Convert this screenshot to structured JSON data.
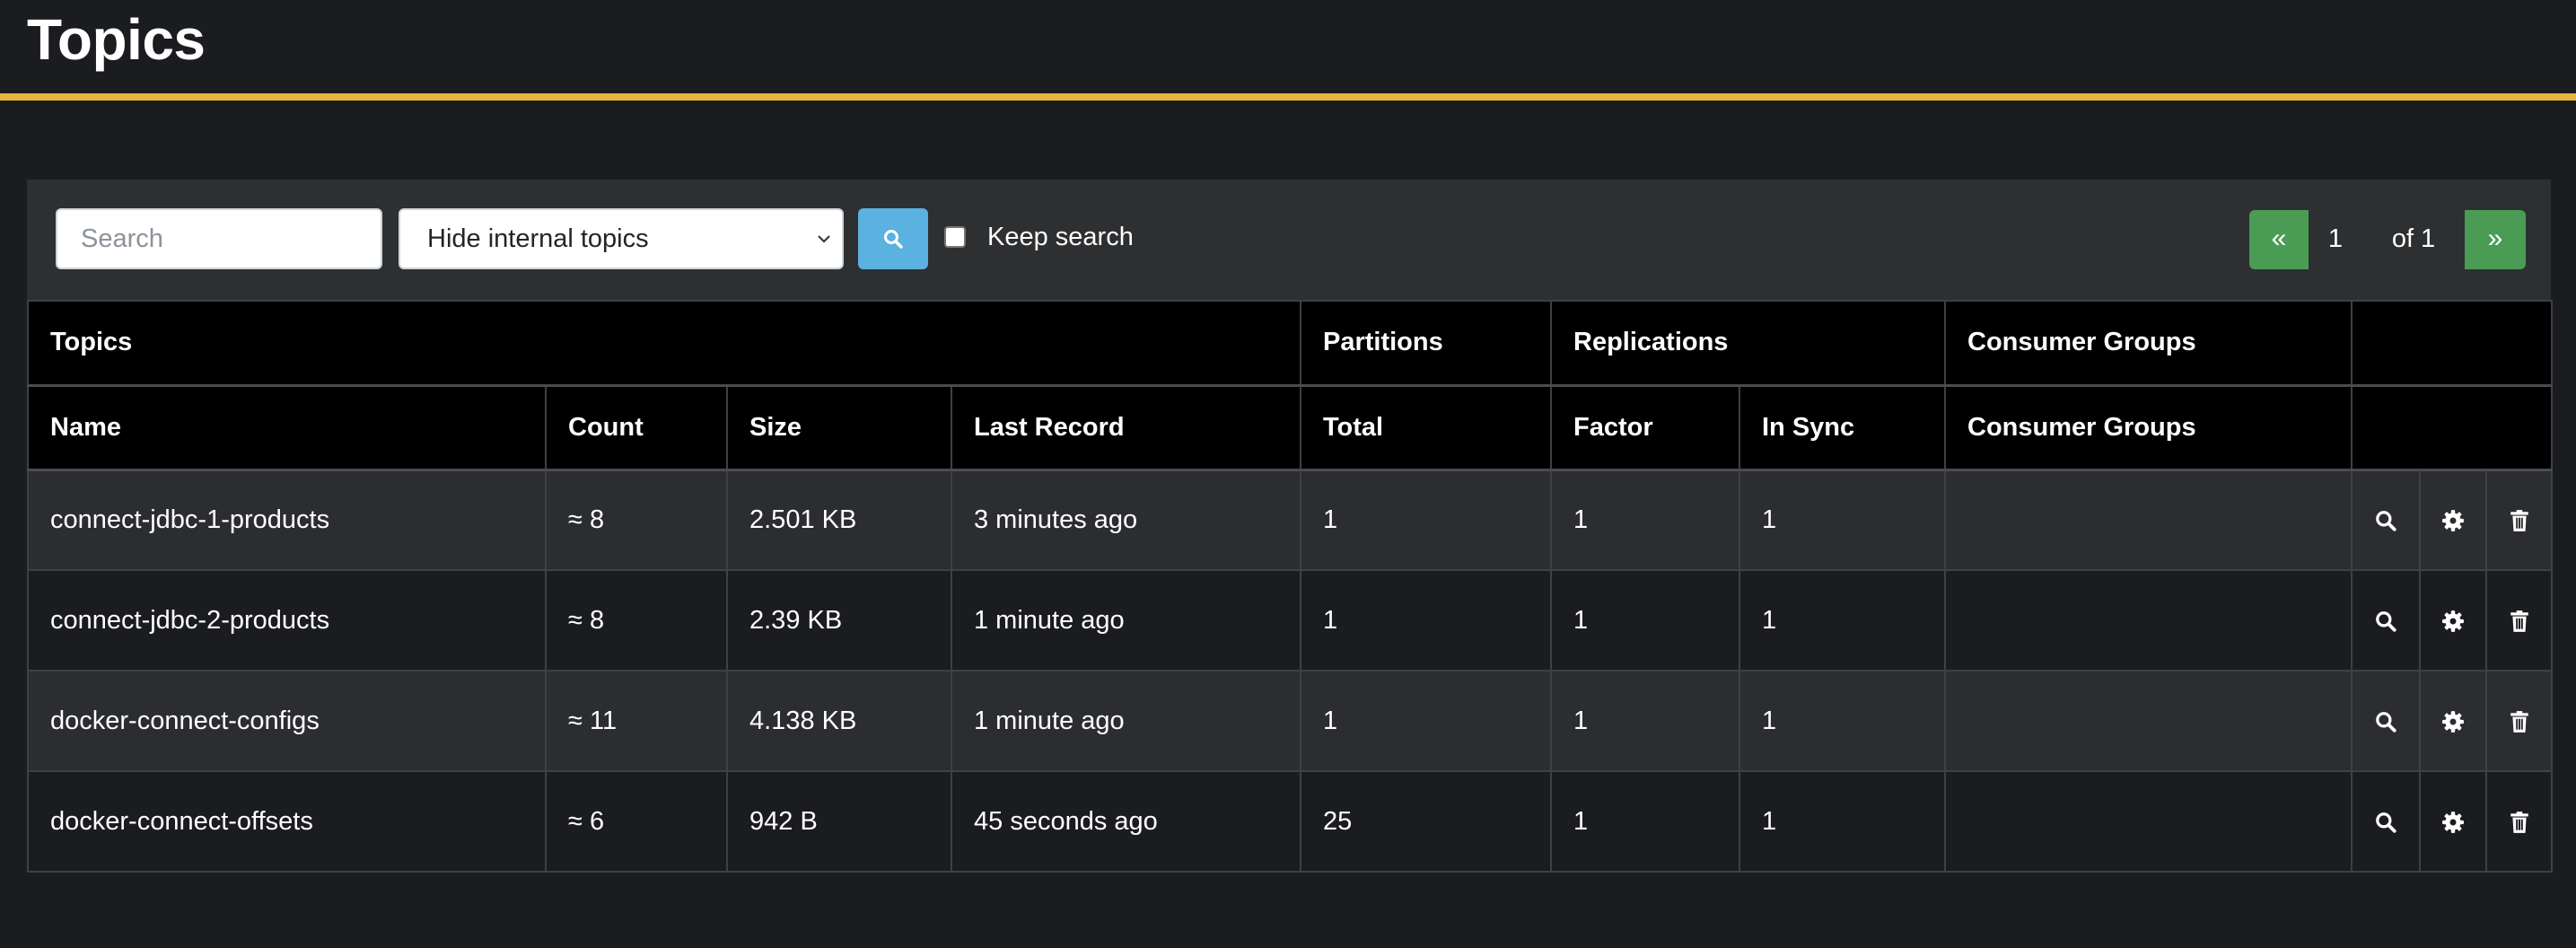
{
  "page": {
    "title": "Topics"
  },
  "colors": {
    "accent": "#e5b53d",
    "pagination_green": "#4a9c55",
    "search_button_blue": "#5bb1e0"
  },
  "toolbar": {
    "search_placeholder": "Search",
    "filter_selected": "Hide internal topics",
    "keep_search_label": "Keep search",
    "keep_search_checked": false
  },
  "pagination": {
    "prev": "«",
    "current": "1",
    "total": "of 1",
    "next": "»"
  },
  "table": {
    "group_headers": {
      "topics": "Topics",
      "partitions": "Partitions",
      "replications": "Replications",
      "consumer_groups": "Consumer Groups"
    },
    "columns": {
      "name": "Name",
      "count": "Count",
      "size": "Size",
      "last_record": "Last Record",
      "total": "Total",
      "factor": "Factor",
      "in_sync": "In Sync",
      "consumer_groups": "Consumer Groups"
    },
    "rows": [
      {
        "name": "connect-jdbc-1-products",
        "count": "≈ 8",
        "size": "2.501 KB",
        "last_record": "3 minutes ago",
        "total": "1",
        "factor": "1",
        "in_sync": "1",
        "consumer_groups": ""
      },
      {
        "name": "connect-jdbc-2-products",
        "count": "≈ 8",
        "size": "2.39 KB",
        "last_record": "1 minute ago",
        "total": "1",
        "factor": "1",
        "in_sync": "1",
        "consumer_groups": ""
      },
      {
        "name": "docker-connect-configs",
        "count": "≈ 11",
        "size": "4.138 KB",
        "last_record": "1 minute ago",
        "total": "1",
        "factor": "1",
        "in_sync": "1",
        "consumer_groups": ""
      },
      {
        "name": "docker-connect-offsets",
        "count": "≈ 6",
        "size": "942 B",
        "last_record": "45 seconds ago",
        "total": "25",
        "factor": "1",
        "in_sync": "1",
        "consumer_groups": ""
      }
    ],
    "row_actions": [
      "search-icon",
      "gear-icon",
      "trash-icon"
    ]
  }
}
